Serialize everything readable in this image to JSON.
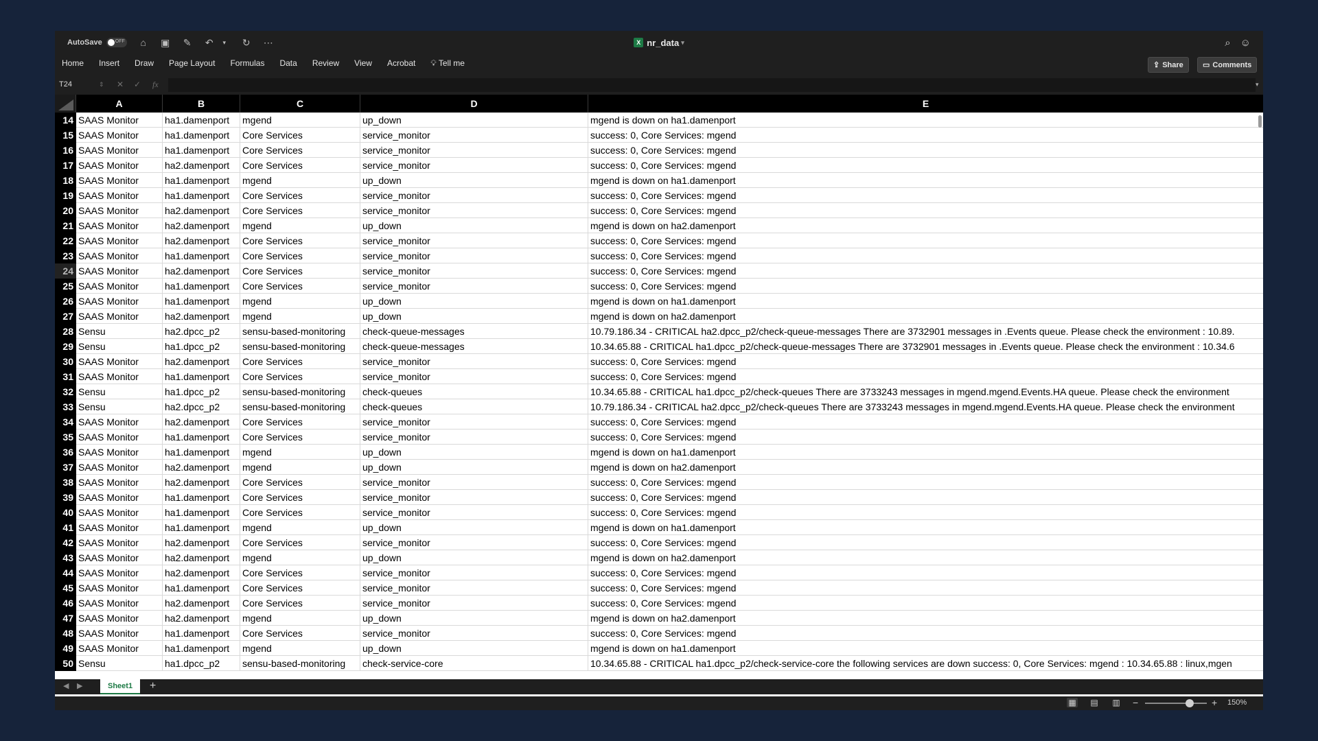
{
  "window": {
    "title": "nr_data",
    "autosave_label": "AutoSave",
    "autosave_state": "OFF"
  },
  "ribbon": {
    "tabs": [
      "Home",
      "Insert",
      "Draw",
      "Page Layout",
      "Formulas",
      "Data",
      "Review",
      "View",
      "Acrobat",
      "Tell me"
    ],
    "share_label": "Share",
    "comments_label": "Comments"
  },
  "formula_bar": {
    "name_box": "T24",
    "fx_label": "fx",
    "value": ""
  },
  "columns": [
    "A",
    "B",
    "C",
    "D",
    "E"
  ],
  "selected_row": 24,
  "rows": [
    {
      "n": "14",
      "a": "SAAS Monitor",
      "b": "ha1.damenport",
      "c": "mgend",
      "d": "up_down",
      "e": "mgend is down on ha1.damenport"
    },
    {
      "n": "15",
      "a": "SAAS Monitor",
      "b": "ha1.damenport",
      "c": "Core Services",
      "d": "service_monitor",
      "e": "success: 0, Core Services: mgend"
    },
    {
      "n": "16",
      "a": "SAAS Monitor",
      "b": "ha1.damenport",
      "c": "Core Services",
      "d": "service_monitor",
      "e": "success: 0, Core Services: mgend"
    },
    {
      "n": "17",
      "a": "SAAS Monitor",
      "b": "ha2.damenport",
      "c": "Core Services",
      "d": "service_monitor",
      "e": "success: 0, Core Services: mgend"
    },
    {
      "n": "18",
      "a": "SAAS Monitor",
      "b": "ha1.damenport",
      "c": "mgend",
      "d": "up_down",
      "e": "mgend is down on ha1.damenport"
    },
    {
      "n": "19",
      "a": "SAAS Monitor",
      "b": "ha1.damenport",
      "c": "Core Services",
      "d": "service_monitor",
      "e": "success: 0, Core Services: mgend"
    },
    {
      "n": "20",
      "a": "SAAS Monitor",
      "b": "ha2.damenport",
      "c": "Core Services",
      "d": "service_monitor",
      "e": "success: 0, Core Services: mgend"
    },
    {
      "n": "21",
      "a": "SAAS Monitor",
      "b": "ha2.damenport",
      "c": "mgend",
      "d": "up_down",
      "e": "mgend is down on ha2.damenport"
    },
    {
      "n": "22",
      "a": "SAAS Monitor",
      "b": "ha2.damenport",
      "c": "Core Services",
      "d": "service_monitor",
      "e": "success: 0, Core Services: mgend"
    },
    {
      "n": "23",
      "a": "SAAS Monitor",
      "b": "ha1.damenport",
      "c": "Core Services",
      "d": "service_monitor",
      "e": "success: 0, Core Services: mgend"
    },
    {
      "n": "24",
      "a": "SAAS Monitor",
      "b": "ha2.damenport",
      "c": "Core Services",
      "d": "service_monitor",
      "e": "success: 0, Core Services: mgend"
    },
    {
      "n": "25",
      "a": "SAAS Monitor",
      "b": "ha1.damenport",
      "c": "Core Services",
      "d": "service_monitor",
      "e": "success: 0, Core Services: mgend"
    },
    {
      "n": "26",
      "a": "SAAS Monitor",
      "b": "ha1.damenport",
      "c": "mgend",
      "d": "up_down",
      "e": "mgend is down on ha1.damenport"
    },
    {
      "n": "27",
      "a": "SAAS Monitor",
      "b": "ha2.damenport",
      "c": "mgend",
      "d": "up_down",
      "e": "mgend is down on ha2.damenport"
    },
    {
      "n": "28",
      "a": "Sensu",
      "b": "ha2.dpcc_p2",
      "c": "sensu-based-monitoring",
      "d": "check-queue-messages",
      "e": "10.79.186.34 - CRITICAL ha2.dpcc_p2/check-queue-messages There are 3732901 messages in .Events queue. Please check the environment : 10.89."
    },
    {
      "n": "29",
      "a": "Sensu",
      "b": "ha1.dpcc_p2",
      "c": "sensu-based-monitoring",
      "d": "check-queue-messages",
      "e": "10.34.65.88 - CRITICAL ha1.dpcc_p2/check-queue-messages There are 3732901 messages in .Events queue. Please check the environment : 10.34.6"
    },
    {
      "n": "30",
      "a": "SAAS Monitor",
      "b": "ha2.damenport",
      "c": "Core Services",
      "d": "service_monitor",
      "e": "success: 0, Core Services: mgend"
    },
    {
      "n": "31",
      "a": "SAAS Monitor",
      "b": "ha1.damenport",
      "c": "Core Services",
      "d": "service_monitor",
      "e": "success: 0, Core Services: mgend"
    },
    {
      "n": "32",
      "a": "Sensu",
      "b": "ha1.dpcc_p2",
      "c": "sensu-based-monitoring",
      "d": "check-queues",
      "e": "10.34.65.88 - CRITICAL ha1.dpcc_p2/check-queues There are 3733243 messages in mgend.mgend.Events.HA queue. Please check the environment"
    },
    {
      "n": "33",
      "a": "Sensu",
      "b": "ha2.dpcc_p2",
      "c": "sensu-based-monitoring",
      "d": "check-queues",
      "e": "10.79.186.34 - CRITICAL ha2.dpcc_p2/check-queues There are 3733243 messages in mgend.mgend.Events.HA queue. Please check the environment"
    },
    {
      "n": "34",
      "a": "SAAS Monitor",
      "b": "ha2.damenport",
      "c": "Core Services",
      "d": "service_monitor",
      "e": "success: 0, Core Services: mgend"
    },
    {
      "n": "35",
      "a": "SAAS Monitor",
      "b": "ha1.damenport",
      "c": "Core Services",
      "d": "service_monitor",
      "e": "success: 0, Core Services: mgend"
    },
    {
      "n": "36",
      "a": "SAAS Monitor",
      "b": "ha1.damenport",
      "c": "mgend",
      "d": "up_down",
      "e": "mgend is down on ha1.damenport"
    },
    {
      "n": "37",
      "a": "SAAS Monitor",
      "b": "ha2.damenport",
      "c": "mgend",
      "d": "up_down",
      "e": "mgend is down on ha2.damenport"
    },
    {
      "n": "38",
      "a": "SAAS Monitor",
      "b": "ha2.damenport",
      "c": "Core Services",
      "d": "service_monitor",
      "e": "success: 0, Core Services: mgend"
    },
    {
      "n": "39",
      "a": "SAAS Monitor",
      "b": "ha1.damenport",
      "c": "Core Services",
      "d": "service_monitor",
      "e": "success: 0, Core Services: mgend"
    },
    {
      "n": "40",
      "a": "SAAS Monitor",
      "b": "ha1.damenport",
      "c": "Core Services",
      "d": "service_monitor",
      "e": "success: 0, Core Services: mgend"
    },
    {
      "n": "41",
      "a": "SAAS Monitor",
      "b": "ha1.damenport",
      "c": "mgend",
      "d": "up_down",
      "e": "mgend is down on ha1.damenport"
    },
    {
      "n": "42",
      "a": "SAAS Monitor",
      "b": "ha2.damenport",
      "c": "Core Services",
      "d": "service_monitor",
      "e": "success: 0, Core Services: mgend"
    },
    {
      "n": "43",
      "a": "SAAS Monitor",
      "b": "ha2.damenport",
      "c": "mgend",
      "d": "up_down",
      "e": "mgend is down on ha2.damenport"
    },
    {
      "n": "44",
      "a": "SAAS Monitor",
      "b": "ha2.damenport",
      "c": "Core Services",
      "d": "service_monitor",
      "e": "success: 0, Core Services: mgend"
    },
    {
      "n": "45",
      "a": "SAAS Monitor",
      "b": "ha1.damenport",
      "c": "Core Services",
      "d": "service_monitor",
      "e": "success: 0, Core Services: mgend"
    },
    {
      "n": "46",
      "a": "SAAS Monitor",
      "b": "ha2.damenport",
      "c": "Core Services",
      "d": "service_monitor",
      "e": "success: 0, Core Services: mgend"
    },
    {
      "n": "47",
      "a": "SAAS Monitor",
      "b": "ha2.damenport",
      "c": "mgend",
      "d": "up_down",
      "e": "mgend is down on ha2.damenport"
    },
    {
      "n": "48",
      "a": "SAAS Monitor",
      "b": "ha1.damenport",
      "c": "Core Services",
      "d": "service_monitor",
      "e": "success: 0, Core Services: mgend"
    },
    {
      "n": "49",
      "a": "SAAS Monitor",
      "b": "ha1.damenport",
      "c": "mgend",
      "d": "up_down",
      "e": "mgend is down on ha1.damenport"
    },
    {
      "n": "50",
      "a": "Sensu",
      "b": "ha1.dpcc_p2",
      "c": "sensu-based-monitoring",
      "d": "check-service-core",
      "e": "10.34.65.88 - CRITICAL ha1.dpcc_p2/check-service-core the following services are down success: 0, Core Services: mgend : 10.34.65.88 : linux,mgen"
    }
  ],
  "sheet_tabs": [
    "Sheet1"
  ],
  "status": {
    "zoom_label": "150%",
    "zoom_percent": 150
  },
  "icons": [
    "home-icon",
    "save-icon",
    "save-as-icon",
    "undo-icon",
    "redo-icon",
    "more-icon",
    "search-icon",
    "smiley-icon",
    "share-icon",
    "comment-icon",
    "lightbulb-icon"
  ],
  "colors": {
    "accent": "#1d7a45",
    "background": "#16233a",
    "chrome": "#1f1f1f"
  }
}
